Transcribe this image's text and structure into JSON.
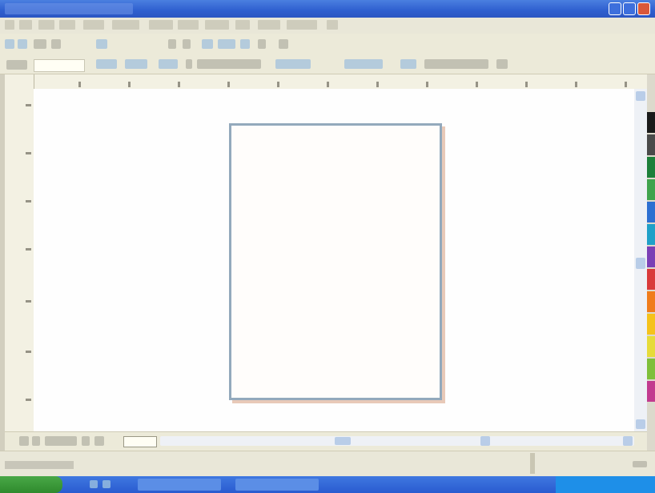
{
  "window": {
    "title": "",
    "controls": [
      "minimize-icon",
      "maximize-icon",
      "close-icon"
    ]
  },
  "menubar": {
    "items": [
      "",
      "",
      "",
      "",
      "",
      "",
      "",
      "",
      "",
      "",
      "",
      "",
      ""
    ]
  },
  "toolbar": {
    "font_value": ""
  },
  "document": {
    "page_tab_label": ""
  },
  "status": {
    "text": ""
  },
  "taskbar": {
    "start_label": "",
    "buttons": [
      "",
      ""
    ],
    "clock": ""
  },
  "colors": {
    "titlebar": "#2f5fcf",
    "page_border": "#93a9bc",
    "taskbar": "#2a5bd0",
    "start": "#2f8a2d"
  },
  "palette": [
    "#1a1a1a",
    "#4a4a4a",
    "#1d7f3a",
    "#3fa34d",
    "#2c6fd1",
    "#1fa0c8",
    "#7b3fb5",
    "#d93a3a",
    "#f07c1b",
    "#f5c21b",
    "#e6db3a",
    "#7fbf3a",
    "#c23b8f"
  ]
}
